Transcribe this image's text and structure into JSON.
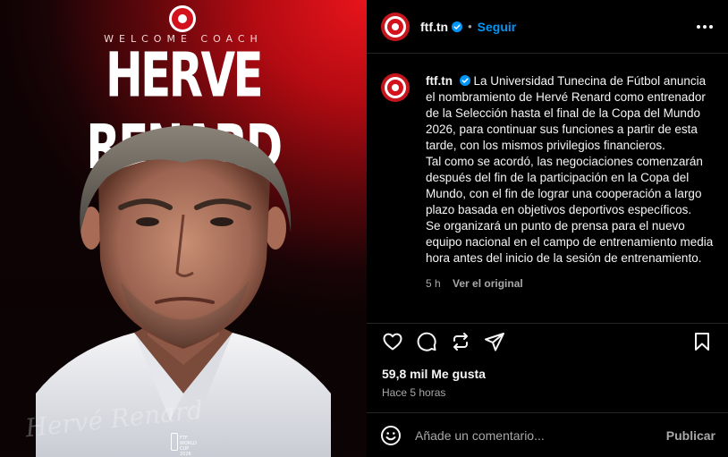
{
  "media": {
    "pretitle": "WELCOME COACH",
    "title": "HERVE RENARD",
    "signature": "Hervé Renard",
    "badge_text": "FTF WORLD CUP 2026"
  },
  "post": {
    "username": "ftf.tn",
    "verified_icon": "verified-badge-icon",
    "follow_label": "Seguir",
    "more_icon": "more-options-icon"
  },
  "caption": {
    "username": "ftf.tn",
    "paragraphs": [
      "La Universidad Tunecina de Fútbol anuncia el nombramiento de Hervé Renard como entrenador de la Selección hasta el final de la Copa del Mundo 2026, para continuar sus funciones a partir de esta tarde, con los mismos privilegios financieros.",
      "Tal como se acordó, las negociaciones comenzarán después del fin de la participación en la Copa del Mundo, con el fin de lograr una cooperación a largo plazo basada en objetivos deportivos específicos.",
      "Se organizará un punto de prensa para el nuevo equipo nacional en el campo de entrenamiento media hora antes del inicio de la sesión de entrenamiento."
    ],
    "age": "5 h",
    "see_original": "Ver el original"
  },
  "actions": {
    "like_icon": "heart-icon",
    "comment_icon": "comment-icon",
    "repost_icon": "repost-icon",
    "share_icon": "share-icon",
    "save_icon": "bookmark-icon"
  },
  "stats": {
    "likes": "59,8 mil Me gusta",
    "posted": "Hace 5 horas"
  },
  "comment": {
    "emoji_icon": "emoji-icon",
    "placeholder": "Añade un comentario...",
    "publish_label": "Publicar"
  },
  "colors": {
    "background": "#000000",
    "accent_blue": "#0095f6",
    "brand_red": "#d4121b",
    "muted_text": "#a8a8a8",
    "divider": "#262626"
  }
}
